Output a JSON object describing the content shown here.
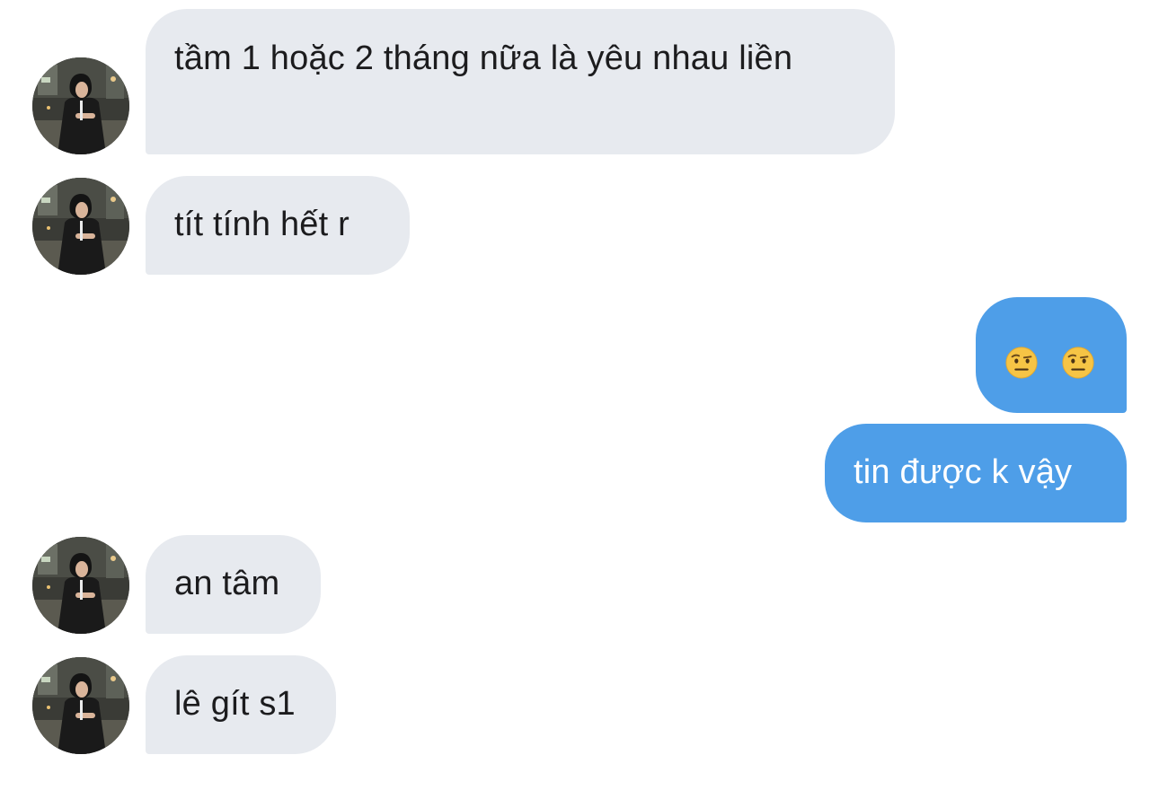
{
  "conversation": {
    "messages": [
      {
        "direction": "incoming",
        "text": "tầm 1 hoặc 2 tháng nữa là yêu nhau liền"
      },
      {
        "direction": "incoming",
        "text": "tít tính hết r"
      },
      {
        "direction": "outgoing",
        "emoji": [
          "raised-eyebrow-emoji",
          "raised-eyebrow-emoji"
        ]
      },
      {
        "direction": "outgoing",
        "text": "tin được k vậy"
      },
      {
        "direction": "incoming",
        "text": "an tâm"
      },
      {
        "direction": "incoming",
        "text": "lê gít s1"
      }
    ]
  },
  "colors": {
    "incoming_bubble": "#e7eaef",
    "outgoing_bubble": "#4e9ee8",
    "incoming_text": "#1c1c1e",
    "outgoing_text": "#ffffff"
  }
}
